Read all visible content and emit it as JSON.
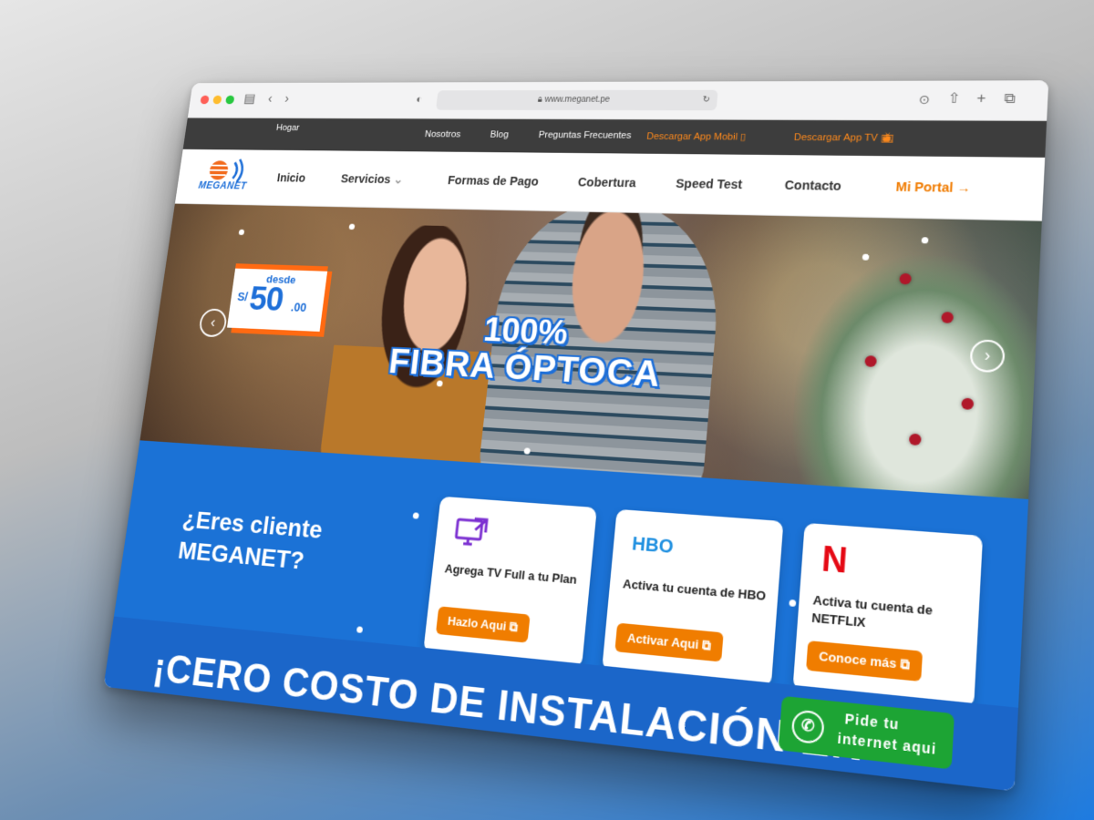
{
  "browser": {
    "url": "www.meganet.pe"
  },
  "topbar": {
    "home": "Hogar",
    "links": [
      "Nosotros",
      "Blog",
      "Preguntas Frecuentes"
    ],
    "app_mobile": "Descargar App Mobil",
    "app_tv": "Descargar App TV"
  },
  "logo": {
    "text": "MEGANET"
  },
  "nav": {
    "items": [
      "Inicio",
      "Servicios",
      "Formas de Pago",
      "Cobertura",
      "Speed Test",
      "Contacto"
    ],
    "portal": "Mi Portal →"
  },
  "hero": {
    "price_from": "desde",
    "currency": "S/",
    "amount": "50",
    "decimals": ".00",
    "headline_1": "100%",
    "headline_2": "FIBRA ÓPTOCA"
  },
  "client": {
    "question_1": "¿Eres cliente",
    "question_2": "MEGANET?",
    "cards": [
      {
        "icon": "tv-external-icon",
        "text": "Agrega TV Full a tu Plan",
        "button": "Hazlo Aqui"
      },
      {
        "icon": "hbo-logo",
        "logo_text": "HBO",
        "text": "Activa tu cuenta de HBO",
        "button": "Activar Aqui"
      },
      {
        "icon": "netflix-logo",
        "logo_text": "N",
        "text": "Activa tu cuenta de NETFLIX",
        "button": "Conoce más"
      }
    ]
  },
  "promo": {
    "headline": "¡CERO COSTO DE INSTALACIÓN EN"
  },
  "whatsapp": {
    "line1": "Pide tu",
    "line2": "internet aqui"
  },
  "colors": {
    "brand_blue": "#1b72d6",
    "accent_orange": "#f07d00",
    "topbar": "#3d3d3d",
    "whatsapp_green": "#1da434"
  }
}
